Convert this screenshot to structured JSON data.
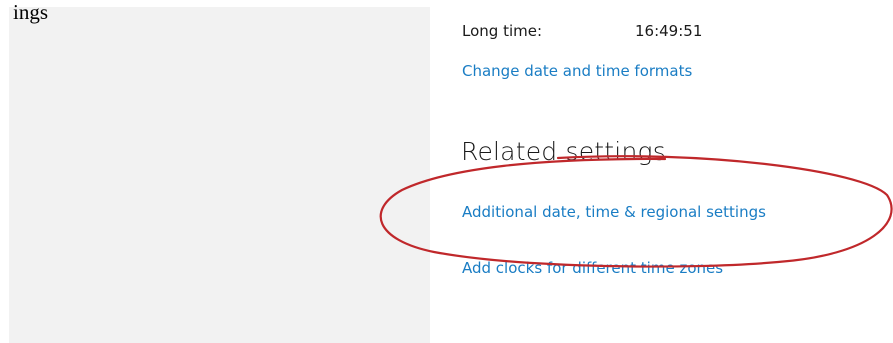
{
  "top_heading": "ings",
  "formats": {
    "long_time_label": "Long time:",
    "long_time_value": "16:49:51",
    "change_link": "Change date and time formats"
  },
  "related": {
    "title": "Related settings",
    "additional_link": "Additional date, time & regional settings",
    "clocks_link": "Add clocks for different time zones"
  },
  "colors": {
    "link": "#1a7dc4",
    "annotation": "#c0282b",
    "left_pane": "#f2f2f2"
  }
}
